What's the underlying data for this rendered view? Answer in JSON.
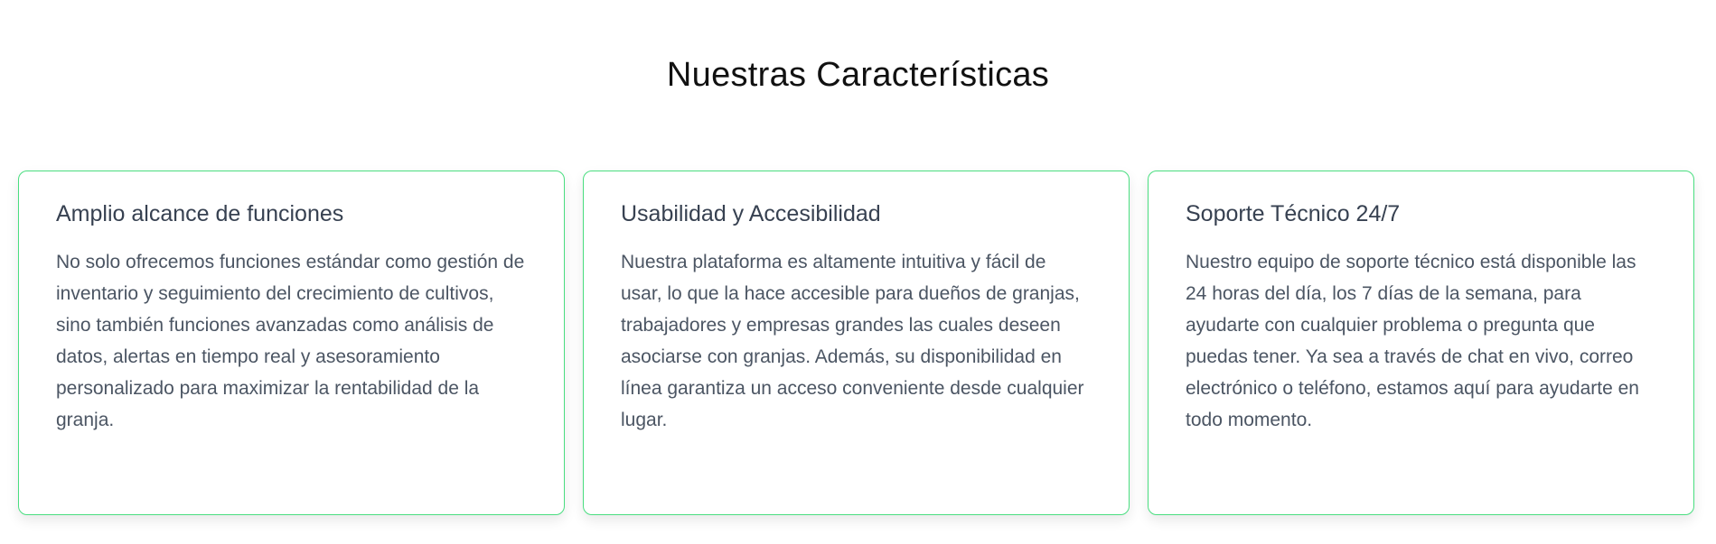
{
  "section": {
    "title": "Nuestras Características"
  },
  "cards": [
    {
      "title": "Amplio alcance de funciones",
      "text": "No solo ofrecemos funciones estándar como gestión de inventario y seguimiento del crecimiento de cultivos, sino también funciones avanzadas como análisis de datos, alertas en tiempo real y asesoramiento personalizado para maximizar la rentabilidad de la granja."
    },
    {
      "title": "Usabilidad y Accesibilidad",
      "text": "Nuestra plataforma es altamente intuitiva y fácil de usar, lo que la hace accesible para dueños de granjas, trabajadores y empresas grandes las cuales deseen asociarse con granjas. Además, su disponibilidad en línea garantiza un acceso conveniente desde cualquier lugar."
    },
    {
      "title": "Soporte Técnico 24/7",
      "text": "Nuestro equipo de soporte técnico está disponible las 24 horas del día, los 7 días de la semana, para ayudarte con cualquier problema o pregunta que puedas tener. Ya sea a través de chat en vivo, correo electrónico o teléfono, estamos aquí para ayudarte en todo momento."
    }
  ],
  "colors": {
    "card_border": "#4ade80",
    "title_text": "#111111",
    "card_title_text": "#374151",
    "card_body_text": "#4b5563"
  }
}
